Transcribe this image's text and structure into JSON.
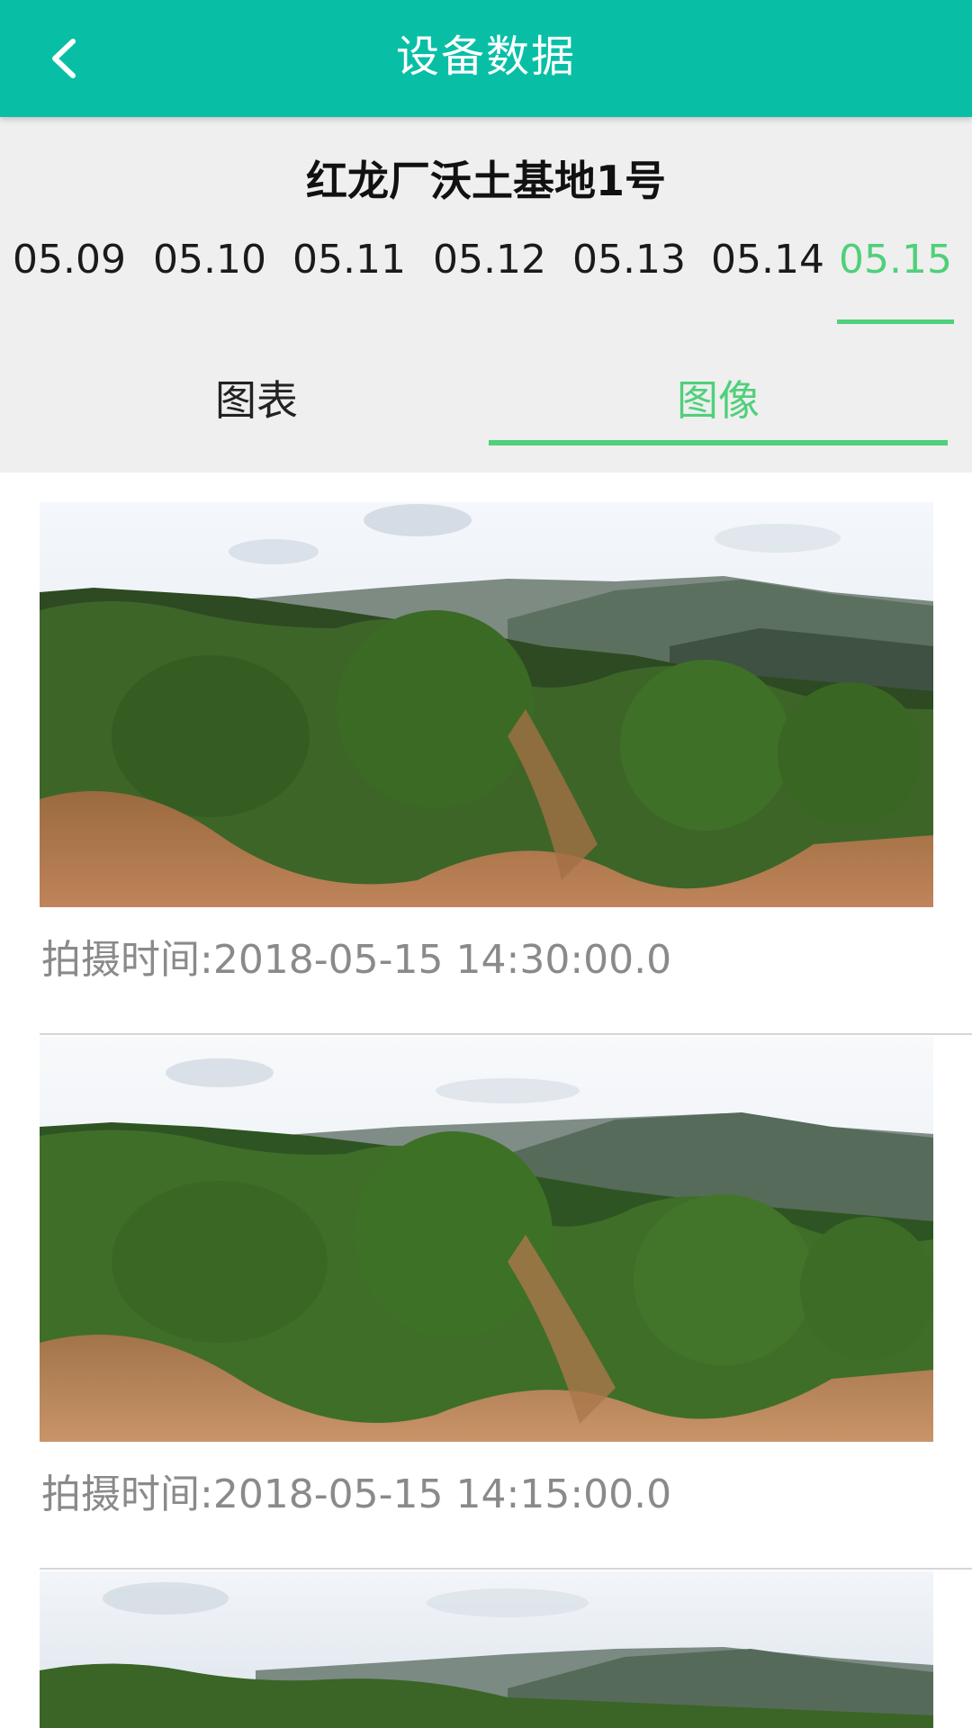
{
  "header": {
    "title": "设备数据",
    "back_icon": "chevron-left-icon",
    "background_color": "#08bfa6"
  },
  "site": {
    "name": "红龙厂沃土基地1号"
  },
  "date_tabs": [
    {
      "label": "05.09",
      "active": false
    },
    {
      "label": "05.10",
      "active": false
    },
    {
      "label": "05.11",
      "active": false
    },
    {
      "label": "05.12",
      "active": false
    },
    {
      "label": "05.13",
      "active": false
    },
    {
      "label": "05.14",
      "active": false
    },
    {
      "label": "05.15",
      "active": true
    }
  ],
  "view_tabs": [
    {
      "label": "图表",
      "active": false
    },
    {
      "label": "图像",
      "active": true
    }
  ],
  "accent_color": "#4fd07a",
  "photos": [
    {
      "caption": "拍摄时间:2018-05-15 14:30:00.0"
    },
    {
      "caption": "拍摄时间:2018-05-15 14:15:00.0"
    },
    {
      "caption": ""
    }
  ]
}
